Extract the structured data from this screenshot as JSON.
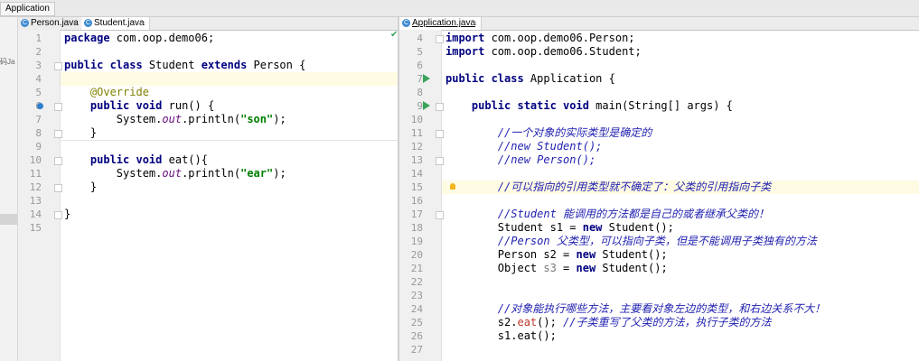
{
  "breadcrumb": "Application",
  "left_strip_text": "码Ja",
  "tabs_left": [
    {
      "label": "Person.java",
      "close": "×"
    },
    {
      "label": "Student.java",
      "close": "×"
    }
  ],
  "tabs_right": [
    {
      "label": "Application.java",
      "close": "×"
    }
  ],
  "left_editor": {
    "line_numbers": [
      "1",
      "2",
      "3",
      "4",
      "5",
      "6",
      "7",
      "8",
      "9",
      "10",
      "11",
      "12",
      "13",
      "14",
      "15"
    ],
    "lines": [
      [
        {
          "t": "package",
          "c": "kw"
        },
        {
          "t": " com.oop.demo06;"
        }
      ],
      [],
      [
        {
          "t": "public class",
          "c": "kw"
        },
        {
          "t": " Student "
        },
        {
          "t": "extends",
          "c": "kw"
        },
        {
          "t": " Person {"
        }
      ],
      [],
      [
        {
          "t": "    "
        },
        {
          "t": "@Override",
          "c": "ann"
        }
      ],
      [
        {
          "t": "    "
        },
        {
          "t": "public void",
          "c": "kw"
        },
        {
          "t": " run() {"
        }
      ],
      [
        {
          "t": "        System."
        },
        {
          "t": "out",
          "c": "fld"
        },
        {
          "t": ".println("
        },
        {
          "t": "\"son\"",
          "c": "str"
        },
        {
          "t": ");"
        }
      ],
      [
        {
          "t": "    }"
        }
      ],
      [],
      [
        {
          "t": "    "
        },
        {
          "t": "public void",
          "c": "kw"
        },
        {
          "t": " eat(){"
        }
      ],
      [
        {
          "t": "        System."
        },
        {
          "t": "out",
          "c": "fld"
        },
        {
          "t": ".println("
        },
        {
          "t": "\"ear\"",
          "c": "str"
        },
        {
          "t": ");"
        }
      ],
      [
        {
          "t": "    }"
        }
      ],
      [],
      [
        {
          "t": "}"
        }
      ],
      []
    ]
  },
  "right_editor": {
    "line_numbers": [
      "4",
      "5",
      "6",
      "7",
      "8",
      "9",
      "10",
      "11",
      "12",
      "13",
      "14",
      "15",
      "16",
      "17",
      "18",
      "19",
      "20",
      "21",
      "22",
      "23",
      "24",
      "25",
      "26",
      "27"
    ],
    "lines": [
      [
        {
          "t": "import",
          "c": "kw"
        },
        {
          "t": " com.oop.demo06.Person;"
        }
      ],
      [
        {
          "t": "import",
          "c": "kw"
        },
        {
          "t": " com.oop.demo06.Student;"
        }
      ],
      [],
      [
        {
          "t": "public class",
          "c": "kw"
        },
        {
          "t": " Application {"
        }
      ],
      [],
      [
        {
          "t": "    "
        },
        {
          "t": "public static void",
          "c": "kw"
        },
        {
          "t": " main(String[] args) {"
        }
      ],
      [],
      [
        {
          "t": "        "
        },
        {
          "t": "//一个对象的实际类型是确定的",
          "c": "cmt"
        }
      ],
      [
        {
          "t": "        "
        },
        {
          "t": "//new Student();",
          "c": "cmt"
        }
      ],
      [
        {
          "t": "        "
        },
        {
          "t": "//new Person();",
          "c": "cmt"
        }
      ],
      [],
      [
        {
          "t": "        "
        },
        {
          "t": "//可以指向的引用类型就不确定了：父类的引用指向子类",
          "c": "cmt"
        }
      ],
      [],
      [
        {
          "t": "        "
        },
        {
          "t": "//Student 能调用的方法都是自己的或者继承父类的！",
          "c": "cmt"
        }
      ],
      [
        {
          "t": "        Student s1 = "
        },
        {
          "t": "new",
          "c": "kw"
        },
        {
          "t": " Student();"
        }
      ],
      [
        {
          "t": "        "
        },
        {
          "t": "//Person 父类型，可以指向子类，但是不能调用子类独有的方法",
          "c": "cmt"
        }
      ],
      [
        {
          "t": "        Person s2 = "
        },
        {
          "t": "new",
          "c": "kw"
        },
        {
          "t": " Student();"
        }
      ],
      [
        {
          "t": "        Object "
        },
        {
          "t": "s3",
          "c": "unused"
        },
        {
          "t": " = "
        },
        {
          "t": "new",
          "c": "kw"
        },
        {
          "t": " Student();"
        }
      ],
      [],
      [],
      [
        {
          "t": "        "
        },
        {
          "t": "//对象能执行哪些方法，主要看对象左边的类型，和右边关系不大！",
          "c": "cmt"
        }
      ],
      [
        {
          "t": "        s2."
        },
        {
          "t": "eat",
          "c": "mcall"
        },
        {
          "t": "(); "
        },
        {
          "t": "//子类重写了父类的方法，执行子类的方法",
          "c": "cmt"
        }
      ],
      [
        {
          "t": "        s1.eat();"
        }
      ],
      []
    ]
  },
  "icons": {
    "run_gutter": "run-icon",
    "fold": "fold-icon",
    "bulb": "intention-bulb-icon",
    "override": "override-gutter-icon",
    "ok": "inspection-ok-icon"
  },
  "colors": {
    "keyword": "#000080",
    "string": "#008000",
    "comment": "#1f1fb0",
    "annotation": "#808000",
    "highlight_line": "#fffbe3"
  }
}
